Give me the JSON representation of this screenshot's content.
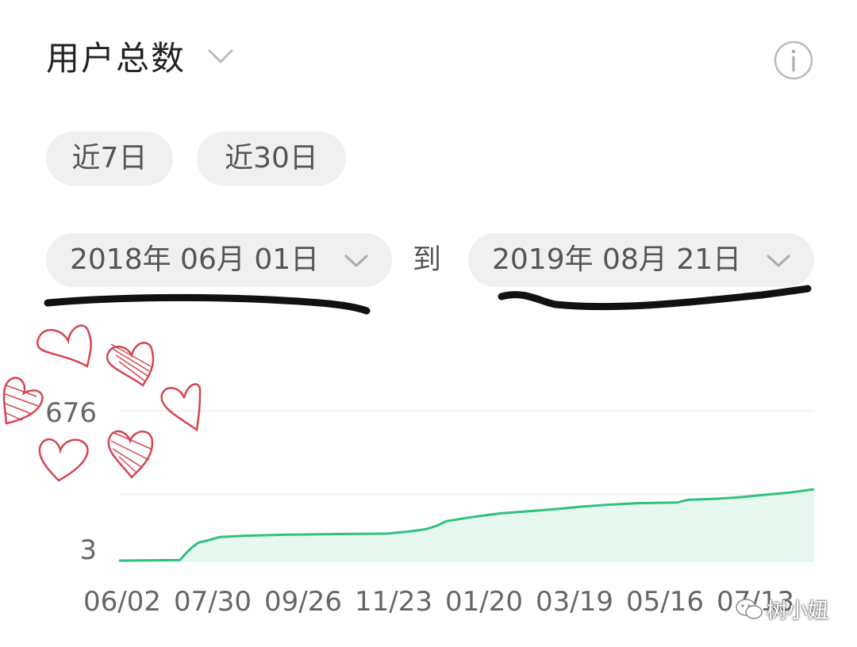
{
  "header": {
    "title": "用户总数",
    "dropdown_icon": "chevron-down-icon",
    "info_icon": "info-icon"
  },
  "quick_ranges": [
    {
      "label": "近7日"
    },
    {
      "label": "近30日"
    }
  ],
  "date_range": {
    "start": "2018年 06月 01日",
    "separator": "到",
    "end": "2019年 08月 21日"
  },
  "colors": {
    "line": "#2ec27e",
    "area": "#e6f8ef",
    "pill_bg": "#f0f0f0",
    "axis_text": "#666666",
    "heart": "#d64550",
    "scribble": "#111111"
  },
  "watermark": {
    "icon": "wechat-icon",
    "text": "树小妞"
  },
  "chart_data": {
    "type": "area",
    "title": "",
    "xlabel": "",
    "ylabel": "",
    "y_tick_labels": [
      "676",
      "3"
    ],
    "ylim": [
      3,
      676
    ],
    "x_tick_labels": [
      "06/02",
      "07/30",
      "09/26",
      "11/23",
      "01/20",
      "03/19",
      "05/16",
      "07/13"
    ],
    "grid": true,
    "legend": "none",
    "series": [
      {
        "x": [
          "2018-06-01",
          "2018-07-10",
          "2018-07-15",
          "2018-07-18",
          "2018-07-22",
          "2018-07-28",
          "2018-08-05",
          "2018-08-20",
          "2018-09-15",
          "2018-10-20",
          "2018-11-20",
          "2018-12-05",
          "2018-12-15",
          "2018-12-22",
          "2018-12-28",
          "2019-01-15",
          "2019-02-01",
          "2019-02-20",
          "2019-03-10",
          "2019-03-25",
          "2019-04-10",
          "2019-04-30",
          "2019-05-25",
          "2019-06-01",
          "2019-06-20",
          "2019-07-05",
          "2019-07-20",
          "2019-08-05",
          "2019-08-21"
        ],
        "y": [
          10,
          12,
          50,
          70,
          90,
          100,
          115,
          120,
          125,
          128,
          130,
          140,
          150,
          165,
          185,
          205,
          220,
          230,
          240,
          250,
          258,
          265,
          268,
          280,
          285,
          292,
          302,
          312,
          327
        ]
      }
    ]
  }
}
